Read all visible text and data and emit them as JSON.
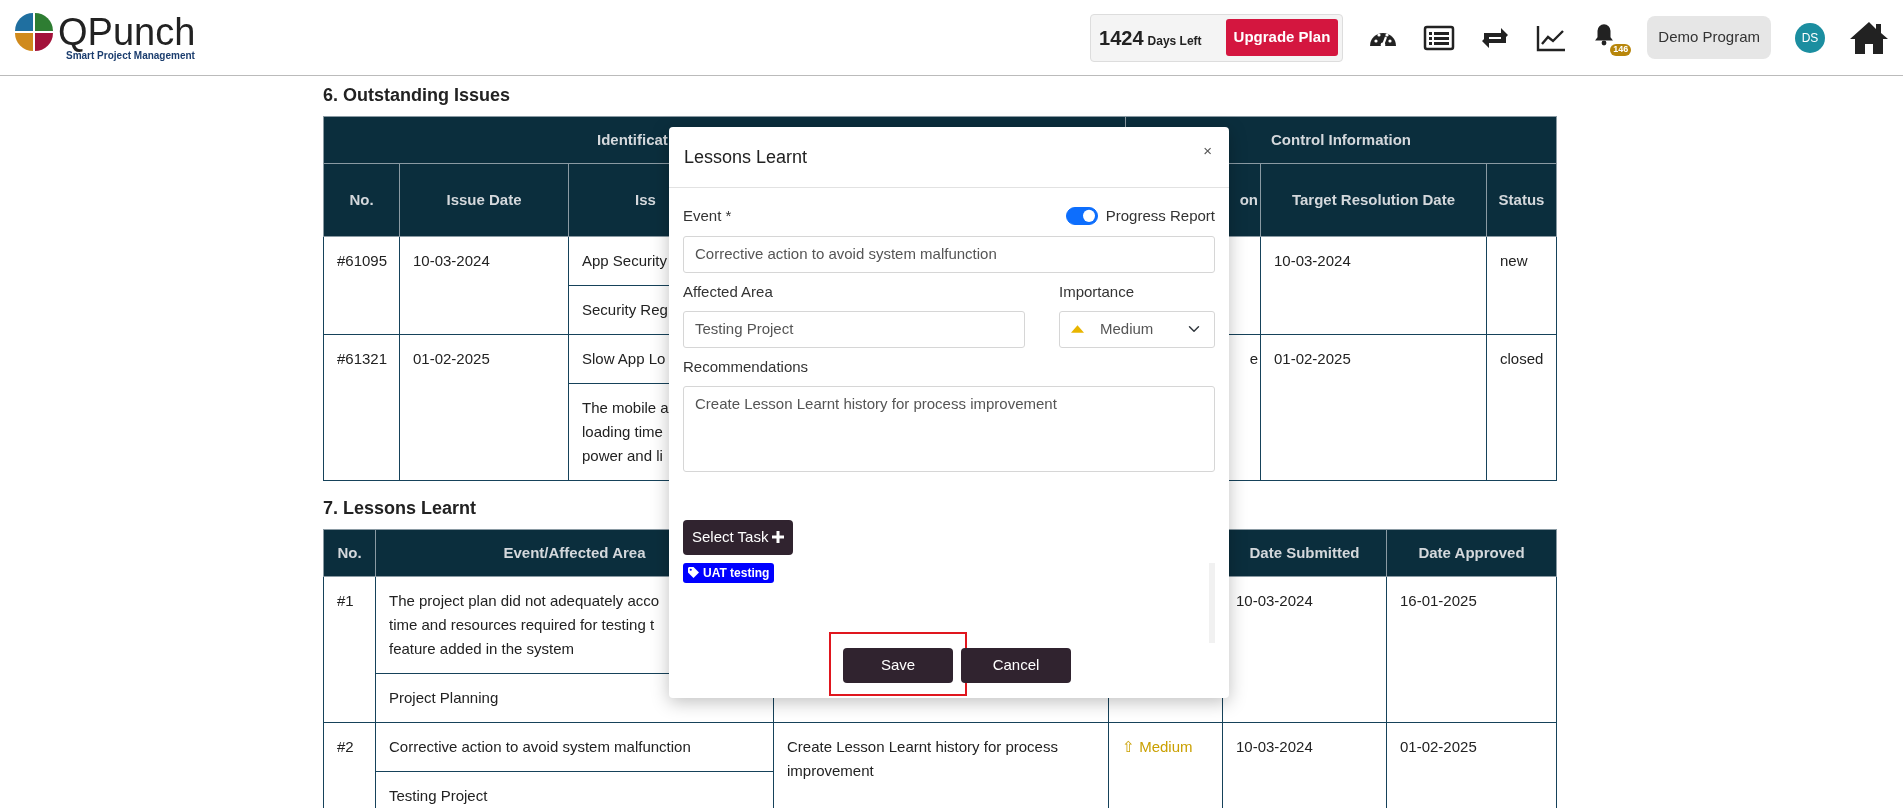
{
  "header": {
    "logo_name": "QPunch",
    "logo_tagline": "Smart Project Management",
    "days_count": "1424",
    "days_label": "Days Left",
    "upgrade_button": "Upgrade Plan",
    "notification_count": "146",
    "program_button": "Demo Program",
    "avatar_initials": "DS"
  },
  "issues_section": {
    "title": "6. Outstanding Issues",
    "group_headers": {
      "identification": "Identificat",
      "control": "Control Information"
    },
    "columns": {
      "no": "No.",
      "issue_date": "Issue Date",
      "issue": "Iss",
      "column_4": "on",
      "target_date": "Target Resolution Date",
      "status": "Status"
    },
    "rows": [
      {
        "no": "#61095",
        "issue_date": "10-03-2024",
        "issue_title": "App Security",
        "issue_detail": [
          "Security Reg"
        ],
        "target_date": "10-03-2024",
        "status": "new"
      },
      {
        "no": "#61321",
        "issue_date": "01-02-2025",
        "issue_title": "Slow App Lo",
        "issue_detail": [
          "The mobile a",
          "loading time",
          "power and li"
        ],
        "column_4": "e",
        "target_date": "01-02-2025",
        "status": "closed"
      }
    ]
  },
  "lessons_section": {
    "title": "7. Lessons Learnt",
    "columns": {
      "no": "No.",
      "event": "Event/Affected Area",
      "date_submitted": "Date Submitted",
      "date_approved": "Date Approved"
    },
    "rows": [
      {
        "no": "#1",
        "event": [
          "The project plan did not adequately acco",
          "time and resources required for testing t",
          "feature added in the system"
        ],
        "affected_area": "Project Planning",
        "date_submitted": "10-03-2024",
        "date_approved": "16-01-2025"
      },
      {
        "no": "#2",
        "event": [
          "Corrective action to avoid system malfunction"
        ],
        "affected_area": "Testing Project",
        "recommendation": "Create Lesson Learnt history for process improvement",
        "importance": "⇧ Medium",
        "date_submitted": "10-03-2024",
        "date_approved": "01-02-2025"
      }
    ]
  },
  "modal": {
    "title": "Lessons Learnt",
    "close": "×",
    "event_label": "Event *",
    "progress_report": {
      "label": "Progress Report",
      "on": true
    },
    "event_value": "Corrective action to avoid system malfunction",
    "affected_area_label": "Affected Area",
    "affected_area_value": "Testing Project",
    "importance_label": "Importance",
    "importance_value": "Medium",
    "recommendations_label": "Recommendations",
    "recommendations_value": "Create Lesson Learnt history for process improvement",
    "select_task_button": "Select Task",
    "tags": [
      {
        "label": "UAT testing"
      }
    ],
    "buttons": [
      {
        "label": "Save",
        "highlighted": true
      },
      {
        "label": "Cancel",
        "highlighted": false
      }
    ]
  }
}
